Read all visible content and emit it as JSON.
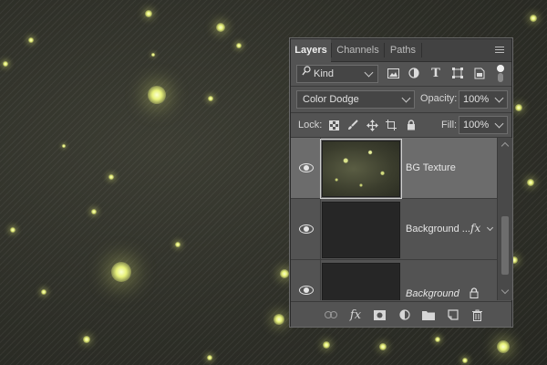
{
  "panel": {
    "tabs": [
      {
        "label": "Layers",
        "active": true
      },
      {
        "label": "Channels",
        "active": false
      },
      {
        "label": "Paths",
        "active": false
      }
    ],
    "filter": {
      "kind_label": "Kind",
      "filter_icons": [
        "image-filter-icon",
        "adjustment-filter-icon",
        "type-filter-icon",
        "shape-filter-icon",
        "smart-object-filter-icon",
        "filter-toggle-icon"
      ]
    },
    "blend_mode": "Color Dodge",
    "opacity": {
      "label": "Opacity:",
      "value": "100%"
    },
    "lock": {
      "label": "Lock:",
      "icons": [
        "lock-transparent-pixels-icon",
        "lock-image-pixels-icon",
        "lock-position-icon",
        "lock-artboard-icon",
        "lock-all-icon"
      ]
    },
    "fill": {
      "label": "Fill:",
      "value": "100%"
    },
    "layers": [
      {
        "name": "BG Texture",
        "selected": true,
        "visible": true,
        "thumb": "texture",
        "italic": false,
        "fx": false,
        "locked": false
      },
      {
        "name": "Background ...",
        "selected": false,
        "visible": true,
        "thumb": "dark",
        "italic": false,
        "fx": true,
        "locked": false
      },
      {
        "name": "Background",
        "selected": false,
        "visible": true,
        "thumb": "dark",
        "italic": true,
        "fx": false,
        "locked": true
      }
    ],
    "fx_label": "fx",
    "bottom_icons": [
      "link-layers-icon",
      "add-layer-style-icon",
      "add-mask-icon",
      "new-fill-adjustment-icon",
      "new-group-icon",
      "new-layer-icon",
      "delete-layer-icon"
    ]
  },
  "colors": {
    "panel_bg": "#535353",
    "selected_row": "#6c6c6c",
    "canvas_glow": "#e8f27a"
  }
}
